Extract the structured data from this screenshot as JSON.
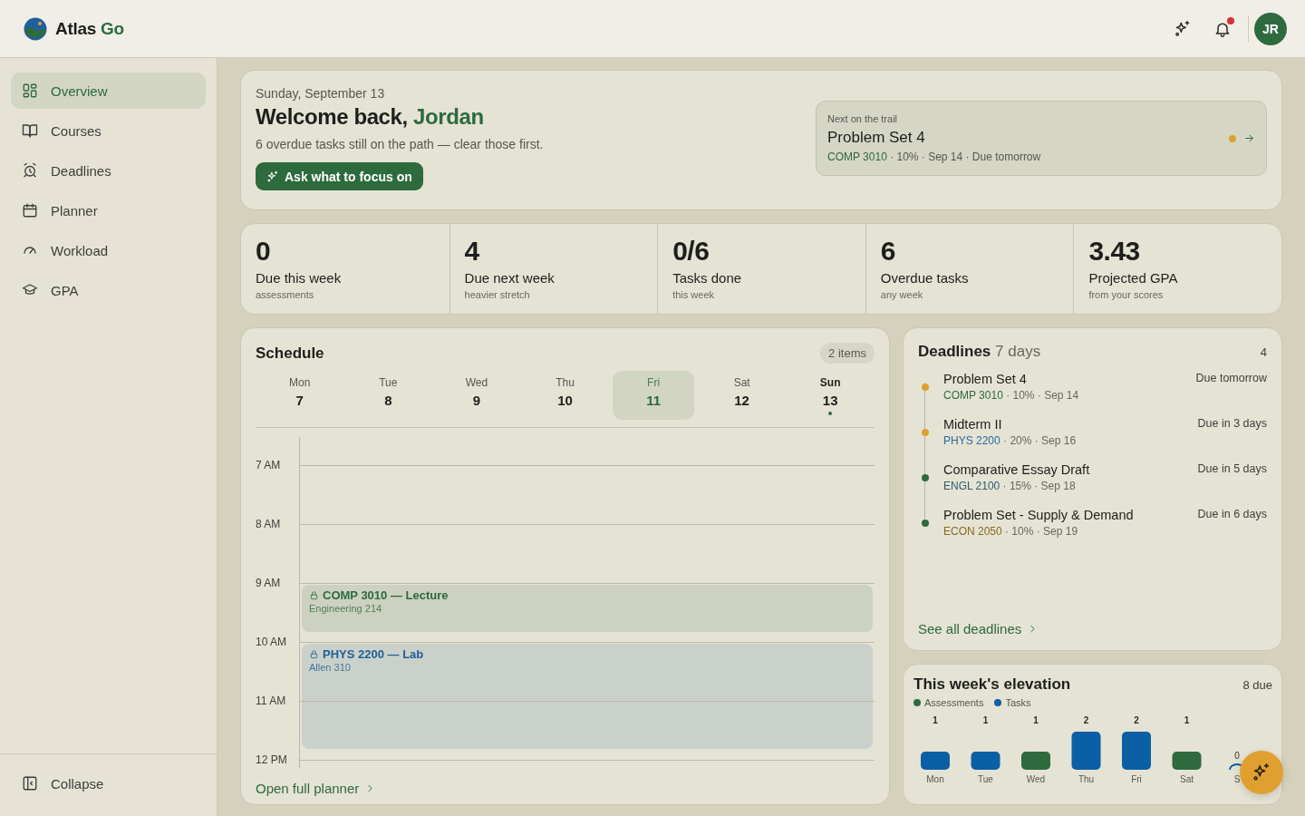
{
  "topbar": {
    "brand": "Atlas",
    "brand_accent": "Go",
    "notifications": {
      "unread": true
    },
    "avatar": "JR"
  },
  "sidebar": {
    "items": [
      {
        "label": "Overview",
        "kind": "grid",
        "selected": true
      },
      {
        "label": "Courses",
        "kind": "book",
        "selected": false
      },
      {
        "label": "Deadlines",
        "kind": "alarm",
        "selected": false
      },
      {
        "label": "Planner",
        "kind": "calendar",
        "selected": false
      },
      {
        "label": "Workload",
        "kind": "gauge",
        "selected": false
      },
      {
        "label": "GPA",
        "kind": "cap",
        "selected": false
      }
    ],
    "collapse": "Collapse"
  },
  "hero": {
    "date": "Sunday, September 13",
    "greeting": "Welcome back,",
    "name": "Jordan",
    "message": "6 overdue tasks still on the path — clear those first.",
    "button": "Ask what to focus on",
    "next": {
      "label": "Next on the trail",
      "title": "Problem Set 4",
      "course": "COMP 3010",
      "meta": " · 10% · Sep 14 · Due tomorrow",
      "color": "#e0a030"
    }
  },
  "stats": [
    {
      "value": "0",
      "label": "Due this week",
      "sub": "assessments"
    },
    {
      "value": "4",
      "label": "Due next week",
      "sub": "heavier stretch"
    },
    {
      "value": "0/6",
      "label": "Tasks done",
      "sub": "this week"
    },
    {
      "value": "6",
      "label": "Overdue tasks",
      "sub": "any week"
    },
    {
      "value": "3.43",
      "label": "Projected GPA",
      "sub": "from your scores"
    }
  ],
  "schedule": {
    "title": "Schedule",
    "count": "2 items",
    "days": [
      {
        "name": "Mon",
        "date": "7",
        "selected": false,
        "today": false
      },
      {
        "name": "Tue",
        "date": "8",
        "selected": false,
        "today": false
      },
      {
        "name": "Wed",
        "date": "9",
        "selected": false,
        "today": false
      },
      {
        "name": "Thu",
        "date": "10",
        "selected": false,
        "today": false
      },
      {
        "name": "Fri",
        "date": "11",
        "selected": true,
        "today": false
      },
      {
        "name": "Sat",
        "date": "12",
        "selected": false,
        "today": false
      },
      {
        "name": "Sun",
        "date": "13",
        "selected": false,
        "today": true
      }
    ],
    "slots": [
      {
        "label": "7 AM"
      },
      {
        "label": "8 AM"
      },
      {
        "label": "9 AM",
        "events": [
          {
            "title": "COMP 3010 — Lecture",
            "location": "Engineering 214",
            "kind": "lecture",
            "color": "#2d6a3e"
          }
        ]
      },
      {
        "label": "10 AM",
        "events": [
          {
            "title": "PHYS 2200 — Lab",
            "location": "Allen 310",
            "kind": "lab",
            "color": "#1f5f94"
          }
        ]
      },
      {
        "label": "11 AM"
      },
      {
        "label": "12 PM"
      }
    ],
    "link": "Open full planner"
  },
  "deadlines": {
    "title": "Deadlines",
    "range": "7 days",
    "count": "4",
    "items": [
      {
        "title": "Problem Set 4",
        "course": {
          "code": "COMP 3010",
          "color": "#2d6a3e"
        },
        "meta": " · 10% · Sep 14",
        "due": "Due tomorrow",
        "color": "#e0a030"
      },
      {
        "title": "Midterm II",
        "course": {
          "code": "PHYS 2200",
          "color": "#2a6a9a"
        },
        "meta": " · 20% · Sep 16",
        "due": "Due in 3 days",
        "color": "#e0a030"
      },
      {
        "title": "Comparative Essay Draft",
        "course": {
          "code": "ENGL 2100",
          "color": "#2d5f6e"
        },
        "meta": " · 15% · Sep 18",
        "due": "Due in 5 days",
        "color": "#2d6a3e"
      },
      {
        "title": "Problem Set - Supply & Demand",
        "course": {
          "code": "ECON 2050",
          "color": "#8a6a1e"
        },
        "meta": " · 10% · Sep 19",
        "due": "Due in 6 days",
        "color": "#2d6a3e"
      }
    ],
    "link": "See all deadlines"
  },
  "elevation": {
    "title": "This week's elevation",
    "count": "8 due",
    "chart_data": {
      "type": "bar",
      "categories": [
        "Mon",
        "Tue",
        "Wed",
        "Thu",
        "Fri",
        "Sat",
        "S"
      ],
      "series": [
        {
          "name": "Assessments",
          "color": "#2d6a3e",
          "values": [
            null,
            null,
            1,
            null,
            null,
            1,
            null
          ],
          "value_labels": [
            null,
            null,
            "1",
            null,
            null,
            "1",
            null
          ]
        },
        {
          "name": "Tasks",
          "color": "#0b5fa5",
          "values": [
            1,
            1,
            null,
            2,
            2,
            null,
            0
          ],
          "value_labels": [
            "1",
            "1",
            null,
            "2",
            "2",
            null,
            "0"
          ]
        }
      ]
    }
  }
}
